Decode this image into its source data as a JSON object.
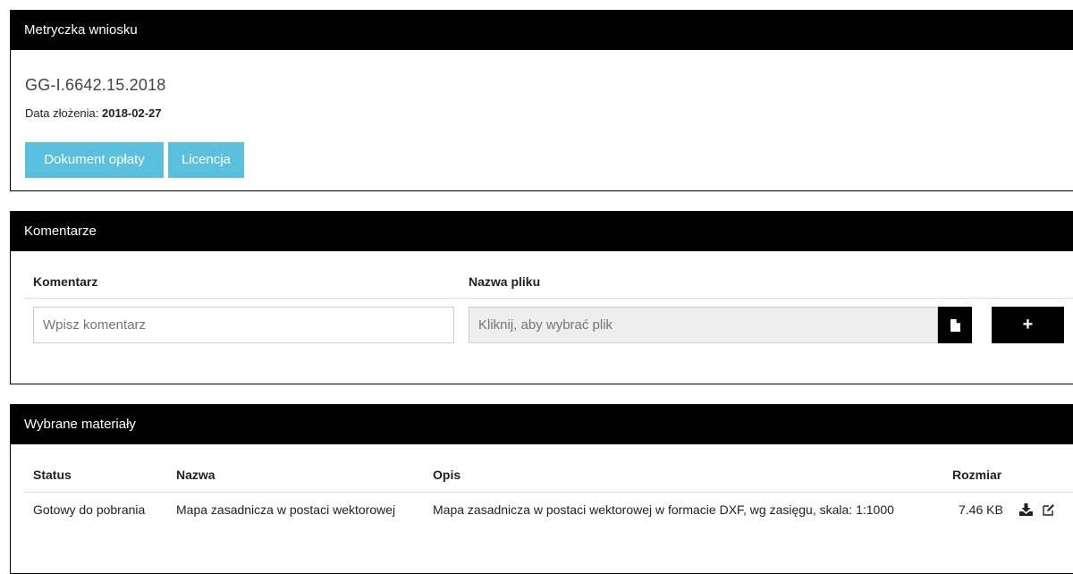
{
  "metryczka": {
    "heading": "Metryczka wniosku",
    "case_number": "GG-I.6642.15.2018",
    "date_label": "Data złożenia:",
    "date_value": "2018-02-27",
    "btn_dokument": "Dokument opłaty",
    "btn_licencja": "Licencja",
    "accent_color": "#5bc0de"
  },
  "komentarze": {
    "heading": "Komentarze",
    "col_komentarz": "Komentarz",
    "col_nazwa_pliku": "Nazwa pliku",
    "comment_placeholder": "Wpisz komentarz",
    "file_placeholder": "Kliknij, aby wybrać plik",
    "file_icon": "file-icon",
    "add_label": "+"
  },
  "materialy": {
    "heading": "Wybrane materiały",
    "columns": [
      "Status",
      "Nazwa",
      "Opis",
      "Rozmiar"
    ],
    "rows": [
      {
        "status": "Gotowy do pobrania",
        "nazwa": "Mapa zasadnicza w postaci wektorowej",
        "opis": "Mapa zasadnicza w postaci wektorowej w formacie DXF, wg zasięgu, skala: 1:1000",
        "rozmiar": "7.46 KB",
        "icons": [
          "download-icon",
          "edit-icon"
        ]
      }
    ]
  }
}
